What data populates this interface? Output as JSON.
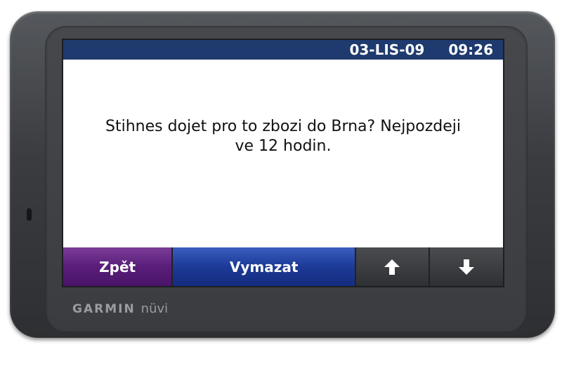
{
  "status_bar": {
    "date": "03-LIS-09",
    "time": "09:26"
  },
  "message": {
    "line1": "Stihnes dojet pro to zbozi do Brna? Nejpozdeji",
    "line2": "ve 12 hodin."
  },
  "buttons": {
    "back_label": "Zpět",
    "clear_label": "Vymazat"
  },
  "device": {
    "brand": "GARMIN",
    "model": "nüvi"
  },
  "colors": {
    "status_bar": "#1e3a6e",
    "back_button": "#5a1e7a",
    "clear_button": "#1c3a96",
    "arrow_button": "#2e3034",
    "bezel": "#3a3c40"
  }
}
